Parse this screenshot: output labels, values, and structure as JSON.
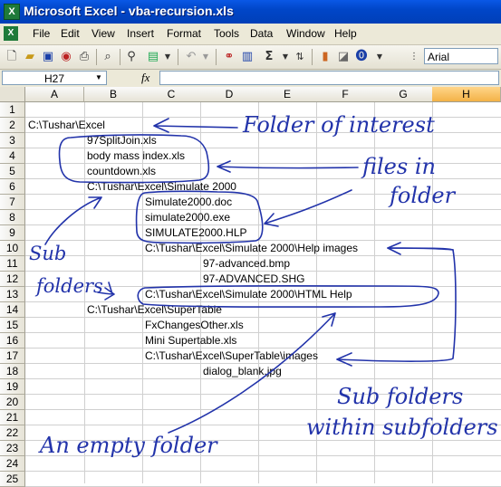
{
  "window": {
    "title": "Microsoft Excel - vba-recursion.xls",
    "app_icon": "X"
  },
  "menu": [
    "File",
    "Edit",
    "View",
    "Insert",
    "Format",
    "Tools",
    "Data",
    "Window",
    "Help"
  ],
  "toolbar": {
    "font_name": "Arial"
  },
  "formula_bar": {
    "name_box": "H27",
    "fx_label": "fx",
    "formula": ""
  },
  "grid": {
    "columns": [
      "A",
      "B",
      "C",
      "D",
      "E",
      "F",
      "G",
      "H"
    ],
    "active_column": "H",
    "rows": [
      "1",
      "2",
      "3",
      "4",
      "5",
      "6",
      "7",
      "8",
      "9",
      "10",
      "11",
      "12",
      "13",
      "14",
      "15",
      "16",
      "17",
      "18",
      "19",
      "20",
      "21",
      "22",
      "23",
      "24",
      "25"
    ],
    "cells": [
      {
        "row": 2,
        "col": "A",
        "text": "C:\\Tushar\\Excel"
      },
      {
        "row": 3,
        "col": "B",
        "text": "97SplitJoin.xls"
      },
      {
        "row": 4,
        "col": "B",
        "text": "body mass index.xls"
      },
      {
        "row": 5,
        "col": "B",
        "text": "countdown.xls"
      },
      {
        "row": 6,
        "col": "B",
        "text": "C:\\Tushar\\Excel\\Simulate 2000"
      },
      {
        "row": 7,
        "col": "C",
        "text": "Simulate2000.doc"
      },
      {
        "row": 8,
        "col": "C",
        "text": "simulate2000.exe"
      },
      {
        "row": 9,
        "col": "C",
        "text": "SIMULATE2000.HLP"
      },
      {
        "row": 10,
        "col": "C",
        "text": "C:\\Tushar\\Excel\\Simulate 2000\\Help images"
      },
      {
        "row": 11,
        "col": "D",
        "text": "97-advanced.bmp"
      },
      {
        "row": 12,
        "col": "D",
        "text": "97-ADVANCED.SHG"
      },
      {
        "row": 13,
        "col": "C",
        "text": "C:\\Tushar\\Excel\\Simulate 2000\\HTML Help"
      },
      {
        "row": 14,
        "col": "B",
        "text": "C:\\Tushar\\Excel\\SuperTable"
      },
      {
        "row": 15,
        "col": "C",
        "text": "FxChangesOther.xls"
      },
      {
        "row": 16,
        "col": "C",
        "text": "Mini Supertable.xls"
      },
      {
        "row": 17,
        "col": "C",
        "text": "C:\\Tushar\\Excel\\SuperTable\\images"
      },
      {
        "row": 18,
        "col": "D",
        "text": "dialog_blank.jpg"
      }
    ]
  },
  "annotations": {
    "folder_of_interest": "Folder of interest",
    "files_in_folder_1": "files in",
    "files_in_folder_2": "folder",
    "sub_folders_1": "Sub",
    "sub_folders_2": "folders",
    "sub_within_1": "Sub folders",
    "sub_within_2": "within subfolders",
    "empty_folder": "An empty folder"
  },
  "colors": {
    "ink": "#2233aa",
    "title_bar": "#0a58e6",
    "active_header": "#f3b247"
  }
}
